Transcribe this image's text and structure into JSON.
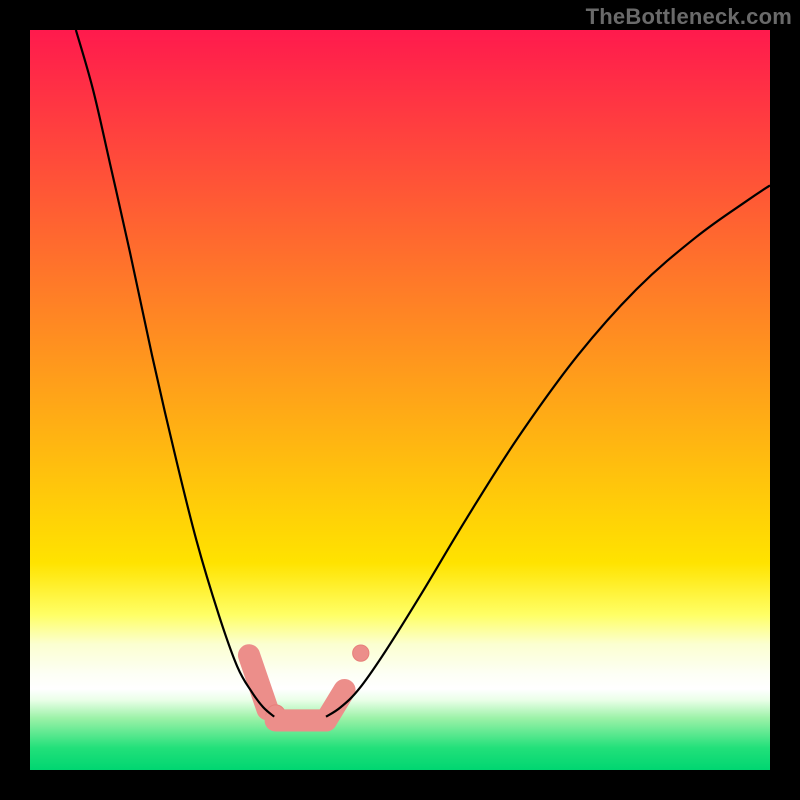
{
  "watermark": "TheBottleneck.com",
  "colors": {
    "black": "#000000",
    "curve": "#000000",
    "marker": "#ec8e8a",
    "marker_stroke": "#e77f7a"
  },
  "chart_data": {
    "type": "line",
    "title": "",
    "xlabel": "",
    "ylabel": "",
    "xlim": [
      0,
      1
    ],
    "ylim": [
      0,
      1
    ],
    "note": "Two-lobe dip chart over a vertical heat gradient. Axes are unlabeled; x and y are normalized 0–1. Curve-left plunges from top-left to the minimum band; curve-right rises from the minimum band toward upper-right. Markers highlight the low region near y≈0.07–0.10.",
    "gradient_bands": [
      {
        "y0": 0.0,
        "y1": 0.72,
        "from": "#ff1a4d",
        "to": "#ffe300"
      },
      {
        "y0": 0.72,
        "y1": 0.79,
        "from": "#ffe300",
        "to": "#ffff66"
      },
      {
        "y0": 0.79,
        "y1": 0.83,
        "from": "#ffff66",
        "to": "#fbffd0"
      },
      {
        "y0": 0.83,
        "y1": 0.87,
        "from": "#fbffd0",
        "to": "#fdfff5"
      },
      {
        "y0": 0.87,
        "y1": 0.89,
        "from": "#fdfff5",
        "to": "#ffffff"
      },
      {
        "y0": 0.89,
        "y1": 0.905,
        "from": "#ffffff",
        "to": "#eaffe8"
      },
      {
        "y0": 0.905,
        "y1": 0.93,
        "from": "#eaffe8",
        "to": "#9cf2a8"
      },
      {
        "y0": 0.93,
        "y1": 0.97,
        "from": "#9cf2a8",
        "to": "#22e07a"
      },
      {
        "y0": 0.97,
        "y1": 1.0,
        "from": "#22e07a",
        "to": "#00d671"
      }
    ],
    "series": [
      {
        "name": "curve-left",
        "points": [
          {
            "x": 0.062,
            "y": 1.0
          },
          {
            "x": 0.085,
            "y": 0.92
          },
          {
            "x": 0.108,
            "y": 0.82
          },
          {
            "x": 0.135,
            "y": 0.7
          },
          {
            "x": 0.165,
            "y": 0.56
          },
          {
            "x": 0.195,
            "y": 0.43
          },
          {
            "x": 0.225,
            "y": 0.31
          },
          {
            "x": 0.255,
            "y": 0.21
          },
          {
            "x": 0.28,
            "y": 0.14
          },
          {
            "x": 0.3,
            "y": 0.105
          },
          {
            "x": 0.315,
            "y": 0.085
          },
          {
            "x": 0.33,
            "y": 0.072
          }
        ]
      },
      {
        "name": "curve-right",
        "points": [
          {
            "x": 0.4,
            "y": 0.072
          },
          {
            "x": 0.42,
            "y": 0.085
          },
          {
            "x": 0.445,
            "y": 0.11
          },
          {
            "x": 0.48,
            "y": 0.16
          },
          {
            "x": 0.53,
            "y": 0.24
          },
          {
            "x": 0.59,
            "y": 0.34
          },
          {
            "x": 0.66,
            "y": 0.45
          },
          {
            "x": 0.74,
            "y": 0.56
          },
          {
            "x": 0.82,
            "y": 0.65
          },
          {
            "x": 0.9,
            "y": 0.72
          },
          {
            "x": 0.97,
            "y": 0.77
          },
          {
            "x": 1.0,
            "y": 0.79
          }
        ]
      }
    ],
    "markers": [
      {
        "shape": "capsule",
        "x0": 0.296,
        "y0": 0.155,
        "x1": 0.321,
        "y1": 0.082,
        "r": 0.015
      },
      {
        "shape": "dot",
        "x": 0.332,
        "y": 0.075,
        "r": 0.013
      },
      {
        "shape": "capsule",
        "x0": 0.332,
        "y0": 0.067,
        "x1": 0.4,
        "y1": 0.067,
        "r": 0.015
      },
      {
        "shape": "capsule",
        "x0": 0.4,
        "y0": 0.067,
        "x1": 0.425,
        "y1": 0.108,
        "r": 0.015
      },
      {
        "shape": "dot",
        "x": 0.447,
        "y": 0.158,
        "r": 0.011
      }
    ]
  }
}
